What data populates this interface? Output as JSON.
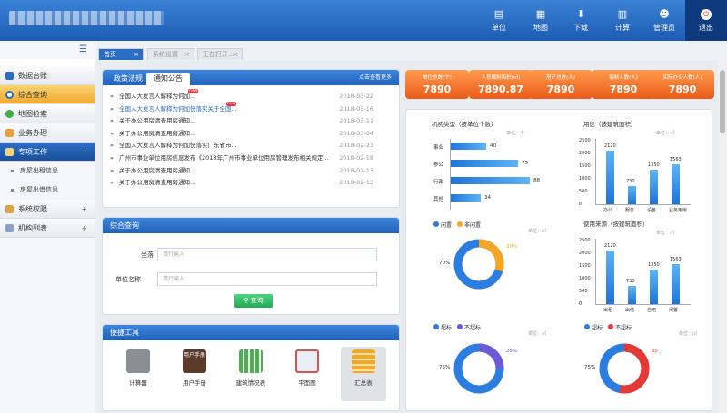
{
  "header": {
    "nav": [
      {
        "label": "单位",
        "icon": "unit-icon"
      },
      {
        "label": "地图",
        "icon": "map-icon"
      },
      {
        "label": "下载",
        "icon": "download-icon"
      },
      {
        "label": "计算",
        "icon": "calculator-icon"
      },
      {
        "label": "管理员",
        "icon": "user-icon"
      },
      {
        "label": "退出",
        "icon": "power-icon"
      }
    ]
  },
  "sidebar": {
    "items": [
      {
        "label": "数据台账",
        "icon": "monitor-icon",
        "expander": ""
      },
      {
        "label": "综合查询",
        "icon": "search-icon",
        "expander": ""
      },
      {
        "label": "地图检索",
        "icon": "map-pin-icon",
        "expander": ""
      },
      {
        "label": "业务办理",
        "icon": "pencil-icon",
        "expander": ""
      },
      {
        "label": "专项工作",
        "icon": "building-icon",
        "expander": "−"
      },
      {
        "label": "系统权限",
        "icon": "gear-icon",
        "expander": "+"
      },
      {
        "label": "机构列表",
        "icon": "list-icon",
        "expander": "+"
      }
    ],
    "subitems": [
      "房屋出租信息",
      "房屋出借信息"
    ]
  },
  "tabs": [
    {
      "label": "首页",
      "close": "×"
    },
    {
      "label": "系统设置",
      "close": "×"
    },
    {
      "label": "正在打开...",
      "close": "×"
    }
  ],
  "notices": {
    "tab1": "政策法规",
    "tab2": "通知公告",
    "more": "点击查看更多",
    "bullet": "»",
    "new_badge": "new",
    "items": [
      {
        "text": "全国人大发言人解释为何加...",
        "date": "2018-03-22",
        "new": true,
        "highlight": false
      },
      {
        "text": "全国人大发言人解释为何加快落实关于全国...",
        "date": "2018-03-16",
        "new": true,
        "highlight": true
      },
      {
        "text": "关于办公用房清查用房通知...",
        "date": "2018-03-11",
        "new": false,
        "highlight": false
      },
      {
        "text": "关于办公用房清查用房通知...",
        "date": "2018-03-04",
        "new": false,
        "highlight": false
      },
      {
        "text": "全国人大发言人解释为何加快落实广东省市...",
        "date": "2018-02-23",
        "new": false,
        "highlight": false
      },
      {
        "text": "广州市事业单位用房信息发布《2018年广州市事业单位用房管理发布相关规定...",
        "date": "2018-02-18",
        "new": false,
        "highlight": false
      },
      {
        "text": "关于办公用房清查用房通知...",
        "date": "2018-02-13",
        "new": false,
        "highlight": false
      },
      {
        "text": "关于办公用房清查用房通知...",
        "date": "2018-02-13",
        "new": false,
        "highlight": false
      }
    ]
  },
  "query": {
    "title": "综合查询",
    "field1_label": "坐落",
    "field1_placeholder": "请行输入",
    "field2_label": "单位名称",
    "field2_placeholder": "请行输入",
    "button": "查询"
  },
  "tools": {
    "title": "便捷工具",
    "items": [
      {
        "label": "计算器",
        "icon": "calculator-tool-icon",
        "color": "#8a8f96"
      },
      {
        "label": "用户手册",
        "icon": "manual-icon",
        "color": "#5b3a2a",
        "caption": "用户手册"
      },
      {
        "label": "建筑情况表",
        "icon": "building-table-icon",
        "color": "#4caf50"
      },
      {
        "label": "平面图",
        "icon": "floorplan-icon",
        "color": "#e9eef4"
      },
      {
        "label": "汇总表",
        "icon": "summary-table-icon",
        "color": "#f5a623"
      }
    ]
  },
  "stats": [
    {
      "label": "单位总数(个)",
      "value": "7890"
    },
    {
      "label": "人员编制面积(㎡)",
      "value": "7890.87"
    },
    {
      "label": "房产总数(人)",
      "value": "7890"
    },
    {
      "label": "编制人数(人)",
      "value": "7890"
    },
    {
      "label": "实际办公人数(人)",
      "value": "7890"
    }
  ],
  "chart_data": [
    {
      "type": "bar",
      "title": "机构类型（按单位个数）",
      "unit": "单位：个",
      "orientation": "horizontal",
      "categories": [
        "事业",
        "参公",
        "行政",
        "其他"
      ],
      "values": [
        40,
        75,
        88,
        34
      ]
    },
    {
      "type": "bar",
      "title": "用途（按建筑面积）",
      "unit": "单位：㎡",
      "categories": [
        "办公",
        "服务",
        "设备",
        "业务用房"
      ],
      "values": [
        2120,
        730,
        1350,
        1563
      ],
      "ylim": [
        0,
        2500
      ],
      "yticks": [
        "2500",
        "2000",
        "1500",
        "1000",
        "500",
        "0"
      ]
    },
    {
      "type": "pie",
      "legend": [
        "闲置",
        "非闲置"
      ],
      "unit": "单位：㎡",
      "values": [
        70,
        30
      ],
      "labels": [
        "70%",
        "30%"
      ],
      "colors": [
        "#2b7de0",
        "#f5a623"
      ]
    },
    {
      "type": "bar",
      "title": "使用来源（按建筑面积）",
      "unit": "单位：㎡",
      "categories": [
        "出租",
        "出借",
        "自用",
        "闲置"
      ],
      "values": [
        2120,
        730,
        1350,
        1563
      ],
      "ylim": [
        0,
        2500
      ],
      "yticks": [
        "2500",
        "2000",
        "1500",
        "1000",
        "500",
        "0"
      ]
    },
    {
      "type": "pie",
      "legend": [
        "超标",
        "不超标"
      ],
      "unit": "单位：㎡",
      "values": [
        75,
        25
      ],
      "labels": [
        "75%",
        "25%"
      ],
      "colors": [
        "#2b7de0",
        "#6b5bd8"
      ]
    },
    {
      "type": "pie",
      "legend": [
        "超标",
        "不超标"
      ],
      "unit": "单位：㎡",
      "values": [
        75,
        85
      ],
      "labels": [
        "75%",
        "85"
      ],
      "colors": [
        "#2b7de0",
        "#e53935"
      ]
    }
  ]
}
